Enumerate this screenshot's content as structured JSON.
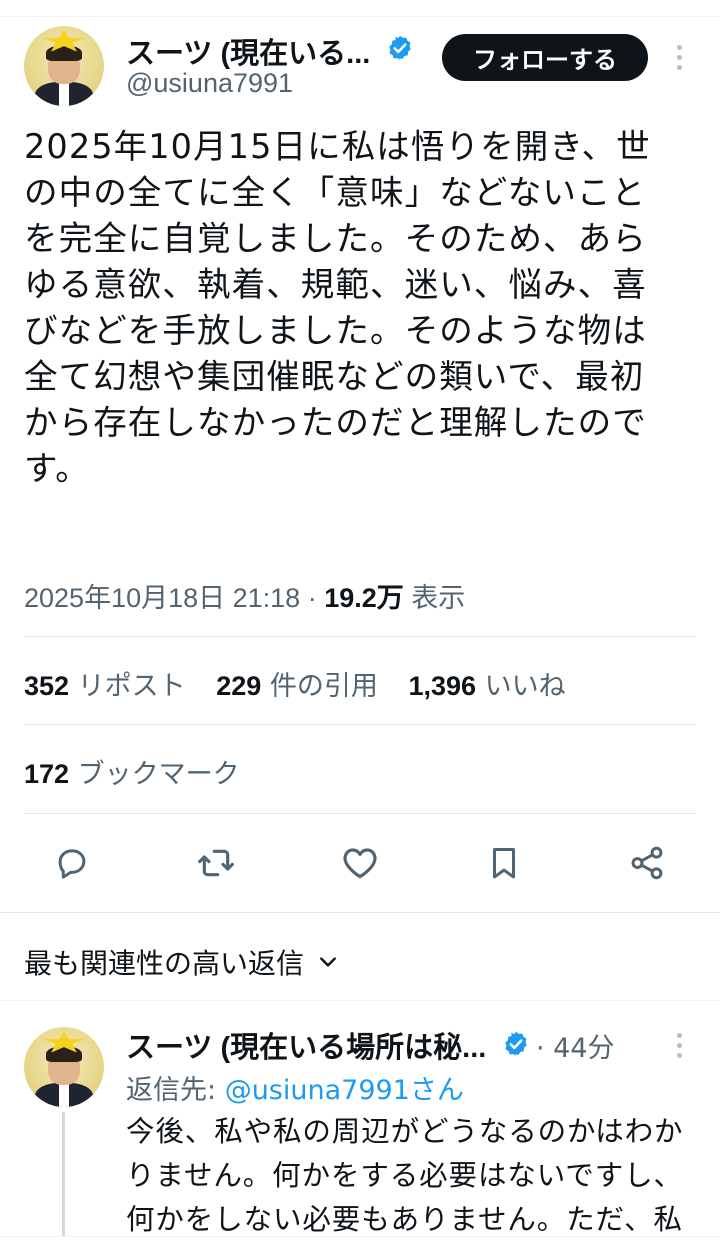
{
  "tweet": {
    "author": {
      "display_name": "スーツ (現在いる...",
      "handle": "@usiuna7991"
    },
    "follow_label": "フォローする",
    "body_lines": [
      "2025年10月15日に私は悟りを開き、世",
      "の中の全てに全く「意味」などないこと",
      "を完全に自覚しました。そのため、あら",
      "ゆる意欲、執着、規範、迷い、悩み、喜",
      "びなどを手放しました。そのような物は",
      "全て幻想や集団催眠などの類いで、最初",
      "から存在しなかったのだと理解したので",
      "す。"
    ],
    "timestamp": "2025年10月18日 21:18",
    "separator": " · ",
    "views": "19.2万",
    "views_label": " 表示",
    "stats": {
      "reposts": "352",
      "reposts_label": "リポスト",
      "quotes": "229",
      "quotes_label": "件の引用",
      "likes": "1,396",
      "likes_label": "いいね",
      "bookmarks": "172",
      "bookmarks_label": "ブックマーク"
    },
    "actions": [
      "reply-icon",
      "retweet-icon",
      "like-icon",
      "bookmark-icon",
      "share-icon"
    ]
  },
  "replies_sort": {
    "label": "最も関連性の高い返信"
  },
  "reply": {
    "display_name": "スーツ (現在いる場所は秘...",
    "time": "· 44分",
    "reply_to_prefix": "返信先: ",
    "reply_to_handle": "@usiuna7991さん",
    "body_lines": [
      "今後、私や私の周辺がどうなるのかはわか",
      "りません。何かをする必要はないですし、",
      "何かをしない必要もありません。ただ、私"
    ]
  },
  "colors": {
    "text": "#0f1419",
    "secondary": "#536471",
    "accent": "#1d9bf0",
    "button": "#0f1419"
  }
}
